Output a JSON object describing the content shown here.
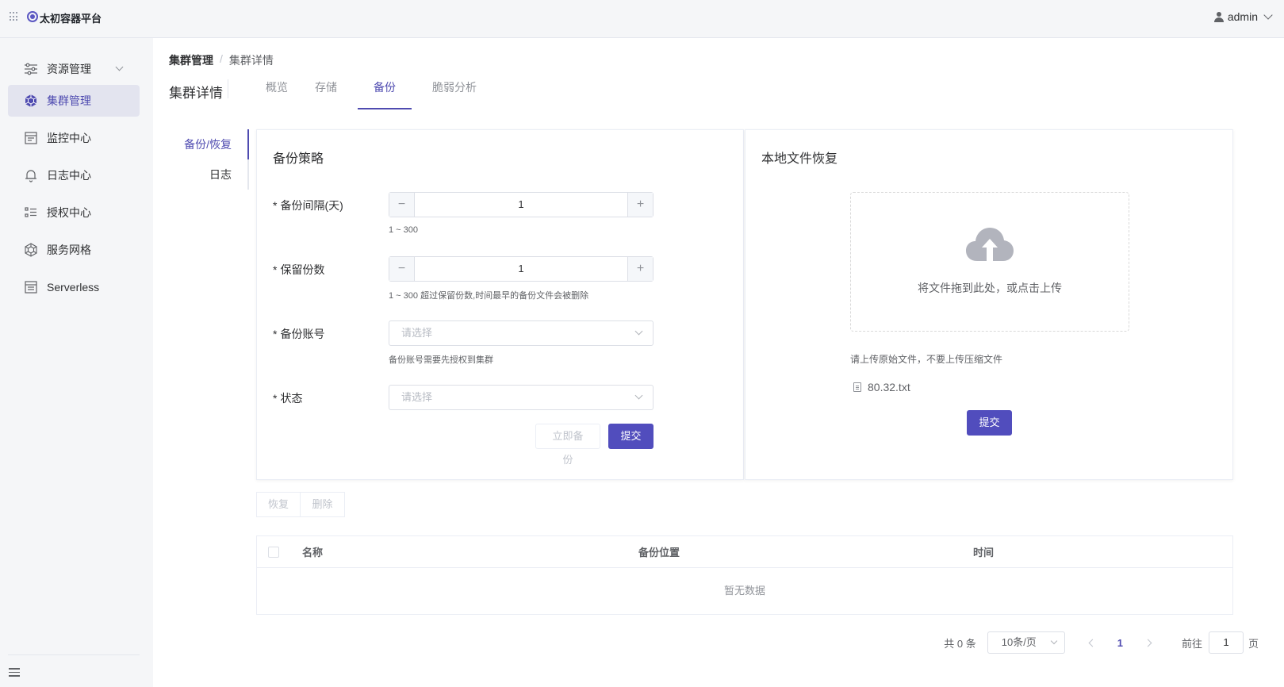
{
  "app": {
    "brand": "太初容器平台",
    "user": "admin"
  },
  "sidebar": {
    "items": [
      {
        "label": "资源管理",
        "icon": "sliders-icon"
      },
      {
        "label": "集群管理",
        "icon": "cluster-icon"
      },
      {
        "label": "监控中心",
        "icon": "monitor-icon"
      },
      {
        "label": "日志中心",
        "icon": "bell-icon"
      },
      {
        "label": "授权中心",
        "icon": "list-icon"
      },
      {
        "label": "服务网格",
        "icon": "mesh-icon"
      },
      {
        "label": "Serverless",
        "icon": "serverless-icon"
      }
    ],
    "active": "集群管理"
  },
  "breadcrumb": {
    "parent": "集群管理",
    "separator": "/",
    "current": "集群详情"
  },
  "page": {
    "title": "集群详情"
  },
  "tabs": [
    "概览",
    "存储",
    "备份",
    "脆弱分析"
  ],
  "active_tab": "备份",
  "subnav": [
    "备份/恢复",
    "日志"
  ],
  "backup_policy": {
    "title": "备份策略",
    "interval": {
      "label": "备份间隔(天)",
      "value": "1",
      "hint": "1 ~ 300"
    },
    "retain": {
      "label": "保留份数",
      "value": "1",
      "hint": "1 ~ 300 超过保留份数,时间最早的备份文件会被删除"
    },
    "account": {
      "label": "备份账号",
      "placeholder": "请选择",
      "hint": "备份账号需要先授权到集群"
    },
    "status": {
      "label": "状态",
      "placeholder": "请选择"
    },
    "required_mark": "*",
    "backup_now": "立即备份",
    "submit": "提交"
  },
  "local_restore": {
    "title": "本地文件恢复",
    "drop_text": "将文件拖到此处，或点击上传",
    "tip": "请上传原始文件，不要上传压缩文件",
    "file_name": "80.32.txt",
    "submit": "提交"
  },
  "actions": {
    "restore": "恢复",
    "delete": "删除"
  },
  "table": {
    "columns": [
      "名称",
      "备份位置",
      "时间"
    ],
    "empty_text": "暂无数据"
  },
  "pagination": {
    "total": "共 0 条",
    "page_size": "10条/页",
    "current_page": "1",
    "goto_label": "前往",
    "goto_value": "1",
    "page_suffix": "页"
  },
  "colors": {
    "accent": "#514dbd",
    "active_bg": "#e3e4ef"
  }
}
